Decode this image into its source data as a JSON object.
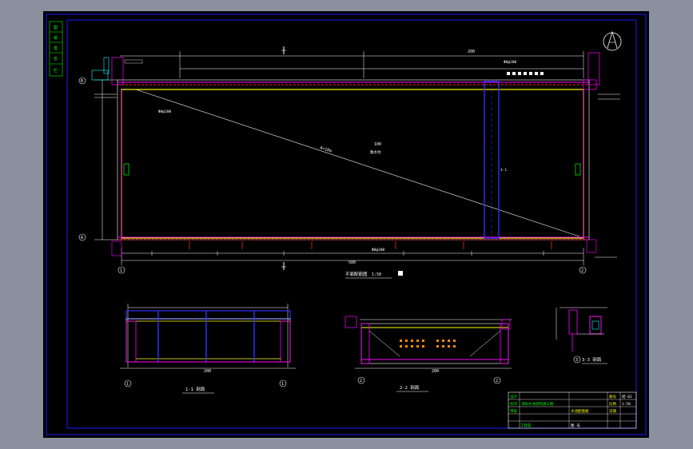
{
  "colors": {
    "viewport_bg": "#8a909e",
    "sheet_bg": "#000000",
    "frame": "#1a1aff",
    "yellow": "#ffff00",
    "magenta": "#ff00ff",
    "red": "#ff2020",
    "white": "#ffffff",
    "cyan": "#00ffff",
    "green": "#00ff00",
    "blue": "#3030ff",
    "orange": "#ff8800"
  },
  "plan": {
    "title": "平面配筋图",
    "scale": "1:50",
    "diagonal_label": "A=10m",
    "center_label": "100",
    "center_sub": "集水坑",
    "overall_dim": "500",
    "top_span": "200",
    "grid_a": "A",
    "grid_b": "B",
    "grid_1": "1",
    "grid_2": "2",
    "section_mark": "1",
    "top_rebar_note": "Φ8@200",
    "bottom_rebar_note": "Φ8@200",
    "left_note": "Φ8@200",
    "center_bar_label": "1-1"
  },
  "sections": [
    {
      "title": "1-1 剖面",
      "dim": "200",
      "num_left": "1",
      "num_right": "1"
    },
    {
      "title": "2-2 剖面",
      "dim": "200",
      "num_left": "2",
      "num_right": "2"
    },
    {
      "title": "3-3 剖面",
      "dim": "",
      "num_left": "3",
      "num_right": ""
    }
  ],
  "title_block": {
    "project": "消防水池结构施工图",
    "drawing": "水池配筋图",
    "row1": "设计",
    "row2": "校对",
    "row3": "审核",
    "row4": "工程名",
    "r1": "图号",
    "r2": "比例",
    "r3": "日期",
    "v1": "结-01",
    "v2": "1:50",
    "v3": "",
    "bottom": "图 号"
  },
  "side_strip": [
    "图",
    "纸",
    "签",
    "名",
    "栏"
  ],
  "north_arrow": "north-arrow-icon"
}
